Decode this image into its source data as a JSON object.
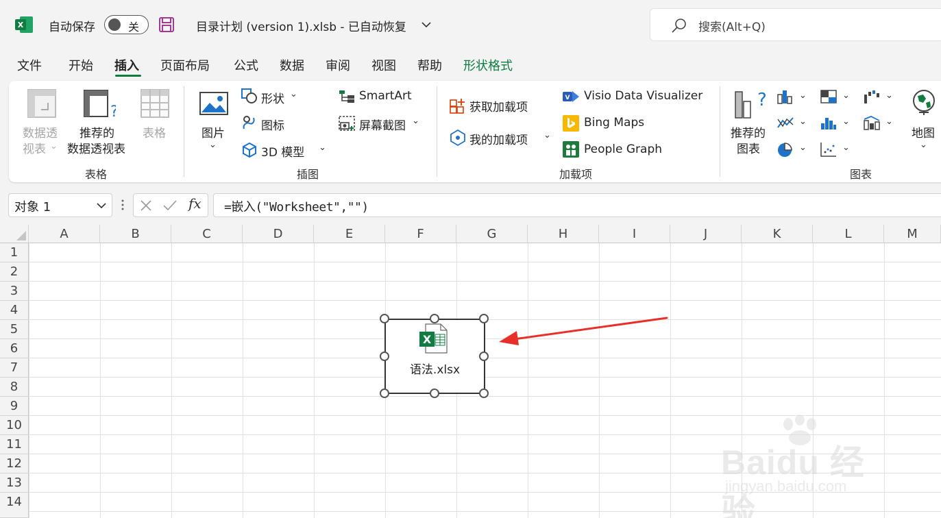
{
  "titlebar": {
    "autosave_label": "自动保存",
    "autosave_state": "关",
    "doc_title": "目录计划 (version 1).xlsb  -  已自动恢复",
    "search_placeholder": "搜索(Alt+Q)"
  },
  "menu": {
    "tabs": [
      "文件",
      "开始",
      "插入",
      "页面布局",
      "公式",
      "数据",
      "审阅",
      "视图",
      "帮助",
      "形状格式"
    ],
    "active": "插入"
  },
  "ribbon": {
    "tables": {
      "pivot_line1": "数据透",
      "pivot_line2": "视表",
      "recommended_line1": "推荐的",
      "recommended_line2": "数据透视表",
      "table": "表格",
      "group": "表格"
    },
    "illustrations": {
      "pictures": "图片",
      "shapes": "形状",
      "icons": "图标",
      "models_3d": "3D 模型",
      "smartart": "SmartArt",
      "screenshot": "屏幕截图",
      "group": "插图"
    },
    "addins": {
      "get_addins": "获取加载项",
      "my_addins": "我的加载项",
      "visio": "Visio Data Visualizer",
      "bing_maps": "Bing Maps",
      "people_graph": "People Graph",
      "group": "加载项"
    },
    "charts": {
      "recommended_line1": "推荐的",
      "recommended_line2": "图表",
      "map": "地图",
      "group": "图表"
    }
  },
  "formula_bar": {
    "name_box": "对象 1",
    "fx": "fx",
    "formula": "=嵌入(\"Worksheet\",\"\")"
  },
  "grid": {
    "columns": [
      "A",
      "B",
      "C",
      "D",
      "E",
      "F",
      "G",
      "H",
      "I",
      "J",
      "K",
      "L",
      "M"
    ],
    "rows": [
      "1",
      "2",
      "3",
      "4",
      "5",
      "6",
      "7",
      "8",
      "9",
      "10",
      "11",
      "12",
      "13",
      "14"
    ]
  },
  "embedded_object": {
    "label": "语法.xlsx"
  },
  "watermark": {
    "brand": "Baidu 经验",
    "url": "jingyan.baidu.com"
  },
  "colors": {
    "excel_green": "#107c41",
    "arrow_red": "#e8302a"
  }
}
